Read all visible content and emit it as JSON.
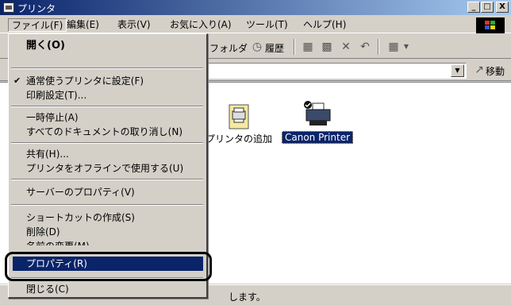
{
  "window": {
    "title": "プリンタ",
    "minimize": "_",
    "maximize": "□",
    "close": "X"
  },
  "menubar": {
    "items": [
      "ファイル(F)",
      "編集(E)",
      "表示(V)",
      "お気に入り(A)",
      "ツール(T)",
      "ヘルプ(H)"
    ]
  },
  "toolbar": {
    "folders": "フォルダ",
    "history": "履歴"
  },
  "address": {
    "go": "移動"
  },
  "content": {
    "add_printer_label": "プリンタの追加",
    "canon_printer_label": "Canon Printer"
  },
  "status": {
    "text": "します。"
  },
  "file_menu": {
    "open": "開く(O)",
    "set_default": "通常使うプリンタに設定(F)",
    "print_settings": "印刷設定(T)...",
    "pause": "一時停止(A)",
    "cancel_all": "すべてのドキュメントの取り消し(N)",
    "sharing": "共有(H)...",
    "use_offline": "プリンタをオフラインで使用する(U)",
    "server_properties": "サーバーのプロパティ(V)",
    "create_shortcut": "ショートカットの作成(S)",
    "delete": "削除(D)",
    "rename": "名前の変更(M)",
    "properties": "プロパティ(R)",
    "close": "閉じる(C)"
  },
  "colors": {
    "titlebar": "#0a246a",
    "highlight": "#0a246a",
    "face": "#d4d0c8"
  }
}
